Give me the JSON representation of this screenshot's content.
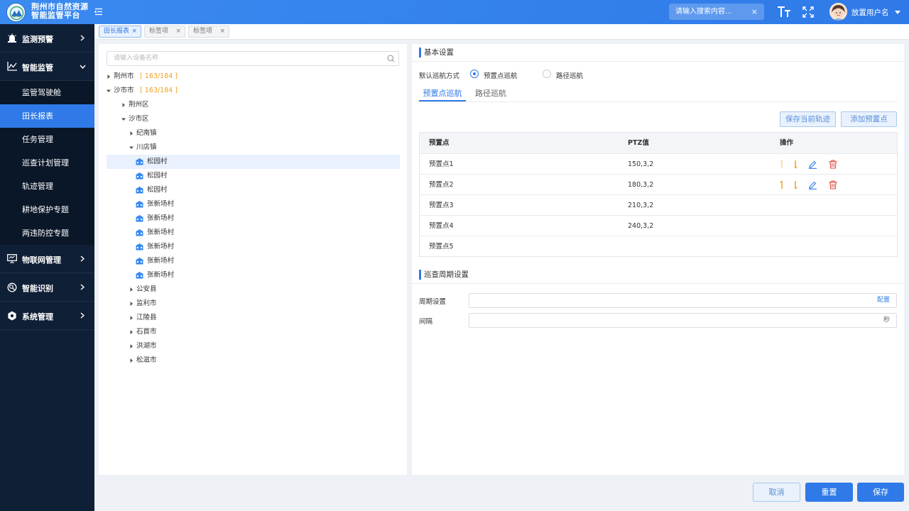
{
  "app": {
    "title_line1": "荆州市自然资源",
    "title_line2": "智能监管平台"
  },
  "header": {
    "search_placeholder": "请输入搜索内容...",
    "search_clear": "×",
    "font_icon": "font-size-icon",
    "fullscreen_icon": "fullscreen-icon",
    "username": "放置用户名"
  },
  "sidebar": {
    "groups": [
      {
        "label": "监测预警",
        "icon": "alarm-icon"
      },
      {
        "label": "智能监管",
        "icon": "line-chart-icon",
        "expanded": true
      },
      {
        "label": "物联网管理",
        "icon": "monitor-icon"
      },
      {
        "label": "智能识别",
        "icon": "recognition-icon"
      },
      {
        "label": "系统管理",
        "icon": "settings-hex-icon"
      }
    ],
    "sub_items": [
      {
        "label": "监管驾驶舱"
      },
      {
        "label": "田长报表",
        "active": true
      },
      {
        "label": "任务管理"
      },
      {
        "label": "巡查计划管理"
      },
      {
        "label": "轨迹管理"
      },
      {
        "label": "耕地保护专题"
      },
      {
        "label": "两违防控专题"
      }
    ]
  },
  "tabs": [
    {
      "label": "田长报表",
      "close": "×",
      "active": true
    },
    {
      "label": "标签项",
      "close": "×"
    },
    {
      "label": "标签项",
      "close": "×"
    }
  ],
  "tree": {
    "search_placeholder": "请输入设备名称",
    "nodes": [
      {
        "label": "荆州市",
        "count": "[ 163/184 ]"
      },
      {
        "label": "沙市市",
        "count": "[ 163/184 ]"
      },
      {
        "label": "荆州区"
      },
      {
        "label": "沙市区"
      },
      {
        "label": "纪南镇"
      },
      {
        "label": "川店镇"
      },
      {
        "label": "松园村"
      },
      {
        "label": "松园村"
      },
      {
        "label": "松园村"
      },
      {
        "label": "张新场村"
      },
      {
        "label": "张新场村"
      },
      {
        "label": "张新场村"
      },
      {
        "label": "张新场村"
      },
      {
        "label": "张新场村"
      },
      {
        "label": "张新场村"
      },
      {
        "label": "公安县"
      },
      {
        "label": "监利市"
      },
      {
        "label": "江陵县"
      },
      {
        "label": "石首市"
      },
      {
        "label": "洪湖市"
      },
      {
        "label": "松滋市"
      }
    ]
  },
  "config": {
    "section_basic": "基本设置",
    "default_mode_label": "默认巡航方式",
    "radio_preset": "预置点巡航",
    "radio_path": "路径巡航",
    "tab_preset": "预置点巡航",
    "tab_path": "路径巡航",
    "btn_save_track": "保存当前轨迹",
    "btn_add_preset": "添加预置点",
    "table": {
      "headers": [
        "预置点",
        "PTZ值",
        "操作"
      ],
      "rows": [
        {
          "name": "预置点1",
          "ptz": "150,3,2"
        },
        {
          "name": "预置点2",
          "ptz": "180,3,2"
        },
        {
          "name": "预置点3",
          "ptz": "210,3,2"
        },
        {
          "name": "预置点4",
          "ptz": "240,3,2"
        },
        {
          "name": "预置点5",
          "ptz": ""
        }
      ]
    },
    "section_period": "巡查周期设置",
    "period_label": "周期设置",
    "period_action": "配置",
    "interval_label": "间隔",
    "interval_unit": "秒"
  },
  "footer": {
    "cancel": "取消",
    "reset": "重置",
    "save": "保存"
  },
  "colors": {
    "primary": "#2f7ae8",
    "sidebar_bg": "#0f1f36",
    "warning": "#f0a020",
    "danger": "#e0443c"
  }
}
